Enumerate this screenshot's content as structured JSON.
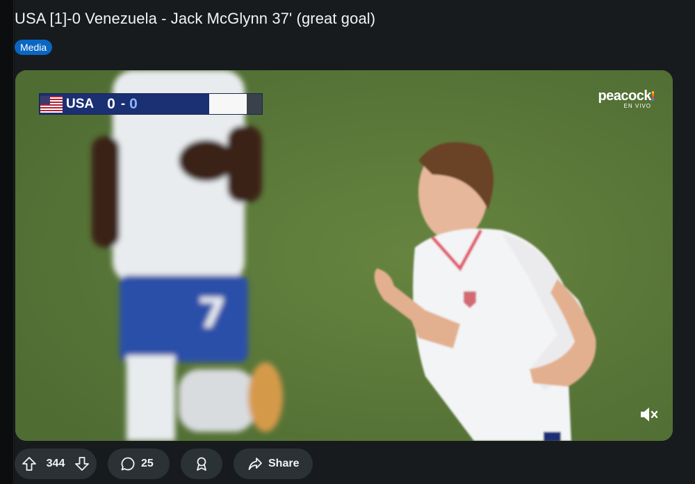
{
  "post": {
    "title": "USA [1]-0 Venezuela - Jack McGlynn 37' (great goal)",
    "flair": "Media"
  },
  "video": {
    "scorebug": {
      "team": "USA",
      "home_score": "0",
      "separator": "-",
      "away_score": "0"
    },
    "broadcaster": {
      "name": "peacock",
      "subtitle": "EN VIVO"
    },
    "mute_icon": "speaker-muted-icon"
  },
  "actions": {
    "upvote_icon": "arrow-up-icon",
    "score": "344",
    "downvote_icon": "arrow-down-icon",
    "comments_icon": "speech-bubble-icon",
    "comments_count": "25",
    "award_icon": "award-ribbon-icon",
    "share_icon": "share-arrow-icon",
    "share_label": "Share"
  },
  "colors": {
    "background": "#0e1113",
    "card": "#171b1e",
    "flair_bg": "#0a66c2",
    "pill_bg": "#2a3236",
    "pitch": "#5e7c3c"
  }
}
